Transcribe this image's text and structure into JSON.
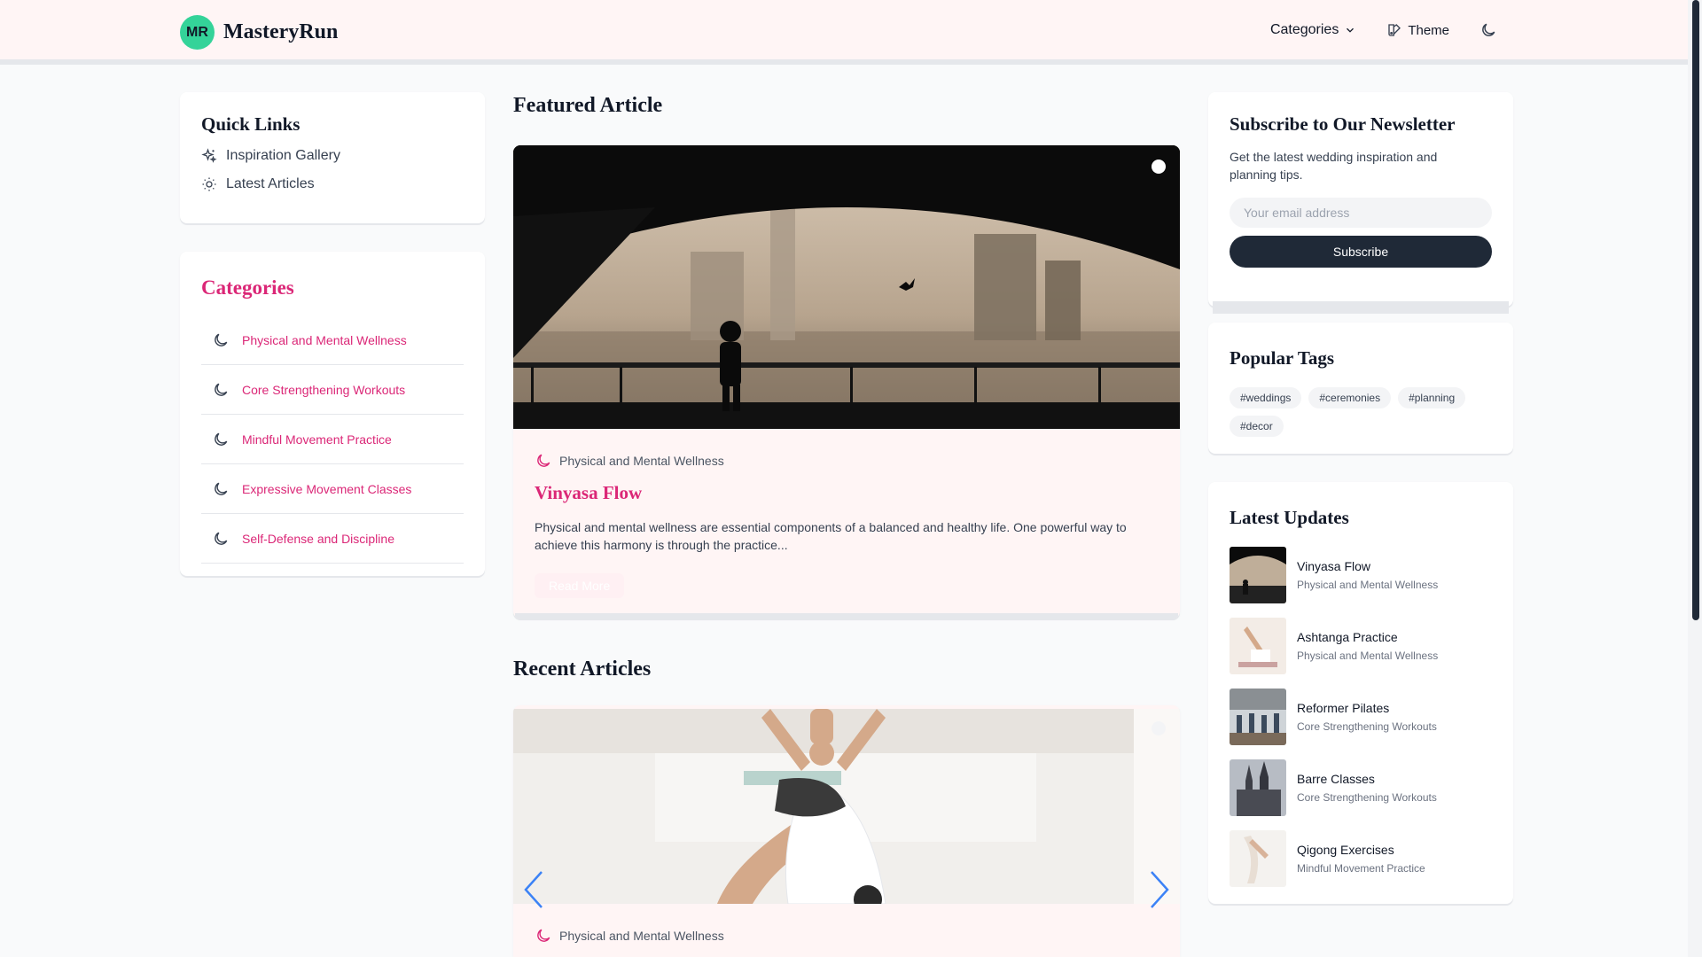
{
  "header": {
    "logo_badge": "MR",
    "logo_text": "MasteryRun",
    "nav": {
      "categories": "Categories",
      "theme": "Theme"
    }
  },
  "quick_links": {
    "title": "Quick Links",
    "items": [
      {
        "label": "Inspiration Gallery",
        "icon": "sparkles-icon"
      },
      {
        "label": "Latest Articles",
        "icon": "sun-icon"
      }
    ]
  },
  "categories": {
    "title": "Categories",
    "items": [
      {
        "label": "Physical and Mental Wellness",
        "icon": "moon-icon"
      },
      {
        "label": "Core Strengthening Workouts",
        "icon": "moon-icon"
      },
      {
        "label": "Mindful Movement Practice",
        "icon": "moon-icon"
      },
      {
        "label": "Expressive Movement Classes",
        "icon": "moon-icon"
      },
      {
        "label": "Self-Defense and Discipline",
        "icon": "moon-icon"
      }
    ]
  },
  "featured": {
    "section_title": "Featured Article",
    "category": "Physical and Mental Wellness",
    "title": "Vinyasa Flow",
    "excerpt": "Physical and mental wellness are essential components of a balanced and healthy life. One powerful way to achieve this harmony is through the practice...",
    "read_more": "Read More"
  },
  "recent": {
    "section_title": "Recent Articles",
    "category": "Physical and Mental Wellness"
  },
  "newsletter": {
    "title": "Subscribe to Our Newsletter",
    "description": "Get the latest wedding inspiration and planning tips.",
    "placeholder": "Your email address",
    "button": "Subscribe"
  },
  "tags": {
    "title": "Popular Tags",
    "items": [
      "#weddings",
      "#ceremonies",
      "#planning",
      "#decor"
    ]
  },
  "updates": {
    "title": "Latest Updates",
    "items": [
      {
        "title": "Vinyasa Flow",
        "category": "Physical and Mental Wellness"
      },
      {
        "title": "Ashtanga Practice",
        "category": "Physical and Mental Wellness"
      },
      {
        "title": "Reformer Pilates",
        "category": "Core Strengthening Workouts"
      },
      {
        "title": "Barre Classes",
        "category": "Core Strengthening Workouts"
      },
      {
        "title": "Qigong Exercises",
        "category": "Mindful Movement Practice"
      }
    ]
  },
  "colors": {
    "accent": "#db2777",
    "header_bg": "#fff5f5",
    "logo_badge": "#34d399",
    "button_dark": "#1f2937",
    "arrow": "#3b82f6"
  }
}
